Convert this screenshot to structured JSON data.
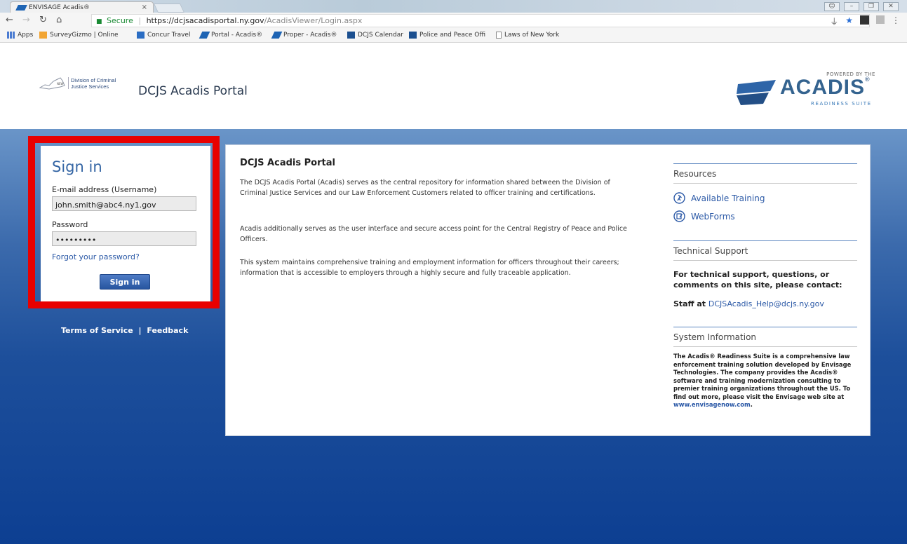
{
  "browser": {
    "tab_title": "ENVISAGE Acadis®",
    "tab_close": "×",
    "url_secure_label": "Secure",
    "url_domain": "https://dcjsacadisportal.ny.gov",
    "url_path": "/AcadisViewer/Login.aspx",
    "bookmarks": [
      {
        "label": "Apps",
        "icon_color": "#4a7bd1"
      },
      {
        "label": "SurveyGizmo | Online",
        "icon_color": "#f2a533"
      },
      {
        "label": "Concur Travel",
        "icon_color": "#2b6dc3"
      },
      {
        "label": "Portal - Acadis®",
        "icon_color": "#1e64b4"
      },
      {
        "label": "Proper - Acadis®",
        "icon_color": "#1e64b4"
      },
      {
        "label": "DCJS Calendar",
        "icon_color": "#1b4f8f"
      },
      {
        "label": "Police and Peace Offi",
        "icon_color": "#1b4f8f"
      },
      {
        "label": "Laws of New York",
        "icon_color": "#888888"
      }
    ]
  },
  "header": {
    "agency_line1": "Division of Criminal",
    "agency_line2": "Justice Services",
    "portal_title": "DCJS Acadis Portal",
    "acadis_powered": "POWERED BY THE",
    "acadis_word": "ACADIS",
    "acadis_suite": "READINESS SUITE"
  },
  "signin": {
    "title": "Sign in",
    "email_label": "E-mail address (Username)",
    "email_value": "john.smith@abc4.ny1.gov",
    "password_label": "Password",
    "password_value": "•••••••••",
    "forgot_link": "Forgot your password?",
    "button_label": "Sign in"
  },
  "footer": {
    "terms": "Terms of Service",
    "separator": "|",
    "feedback": "Feedback"
  },
  "content": {
    "title": "DCJS Acadis Portal",
    "paragraphs": [
      "The DCJS Acadis Portal (Acadis) serves as the central repository for information shared between the Division of Criminal Justice Services and our Law Enforcement Customers related to officer training and certifications.",
      "Acadis additionally serves as the user interface and secure access point for the Central Registry of Peace and Police Officers.",
      "This system maintains comprehensive training and employment information for officers throughout their careers; information that is accessible to employers through a highly secure and fully traceable application."
    ]
  },
  "sidebar": {
    "resources_heading": "Resources",
    "available_training": "Available Training",
    "webforms": "WebForms",
    "tech_support_heading": "Technical Support",
    "tech_support_text": "For technical support, questions, or comments on this site, please contact:",
    "staff_prefix": "Staff at ",
    "staff_email": "DCJSAcadis_Help@dcjs.ny.gov",
    "system_info_heading": "System Information",
    "system_info_text": "The Acadis® Readiness Suite is a comprehensive law enforcement training solution developed by Envisage Technologies. The company provides the Acadis® software and training modernization consulting to premier training organizations throughout the US. To find out more, please visit the Envisage web site at ",
    "envisage_link": "www.envisagenow.com",
    "period": "."
  },
  "colors": {
    "highlight": "#e80000",
    "link": "#2a58a6",
    "button": "#27559f"
  }
}
